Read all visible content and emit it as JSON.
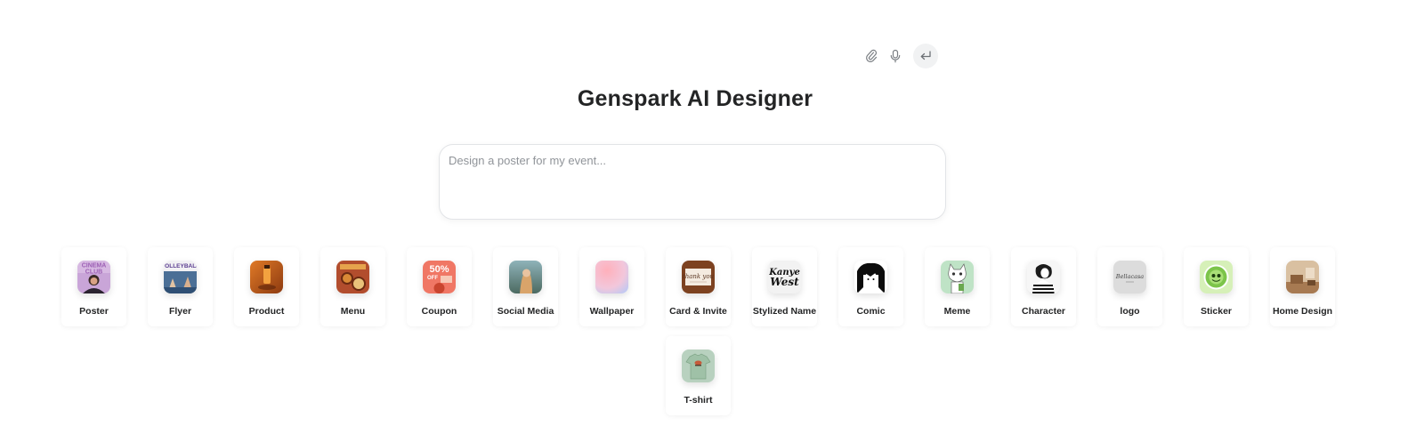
{
  "title": "Genspark AI Designer",
  "search": {
    "placeholder": "Design a poster for my event...",
    "value": ""
  },
  "icons": {
    "attach": "paperclip-icon",
    "mic": "microphone-icon",
    "send": "enter-icon"
  },
  "categories": [
    {
      "label": "Poster",
      "thumb_text": "CINEMA CLUB",
      "color": "#b58ac9"
    },
    {
      "label": "Flyer",
      "thumb_text": "VOLLEYBALL",
      "color": "#5d7ea3"
    },
    {
      "label": "Product",
      "color": "#c9641f"
    },
    {
      "label": "Menu",
      "color": "#b5472b"
    },
    {
      "label": "Coupon",
      "thumb_text": "50% OFF",
      "color": "#ef6f5d"
    },
    {
      "label": "Social Media",
      "color": "#6f8a8c"
    },
    {
      "label": "Wallpaper",
      "color": "#f7b6c4"
    },
    {
      "label": "Card & Invite",
      "thumb_text": "thank you",
      "color": "#8a4a22"
    },
    {
      "label": "Stylized Name",
      "thumb_text": "Kanye West",
      "color": "#1a1a1a"
    },
    {
      "label": "Comic",
      "color": "#000000"
    },
    {
      "label": "Meme",
      "color": "#b9ddc0"
    },
    {
      "label": "Character",
      "color": "#333333"
    },
    {
      "label": "logo",
      "thumb_text": "Bellacasa",
      "color": "#d9d9d9"
    },
    {
      "label": "Sticker",
      "color": "#8ccf5f"
    },
    {
      "label": "Home Design",
      "color": "#a27a55"
    },
    {
      "label": "T-shirt",
      "color": "#a9c4b1"
    }
  ]
}
